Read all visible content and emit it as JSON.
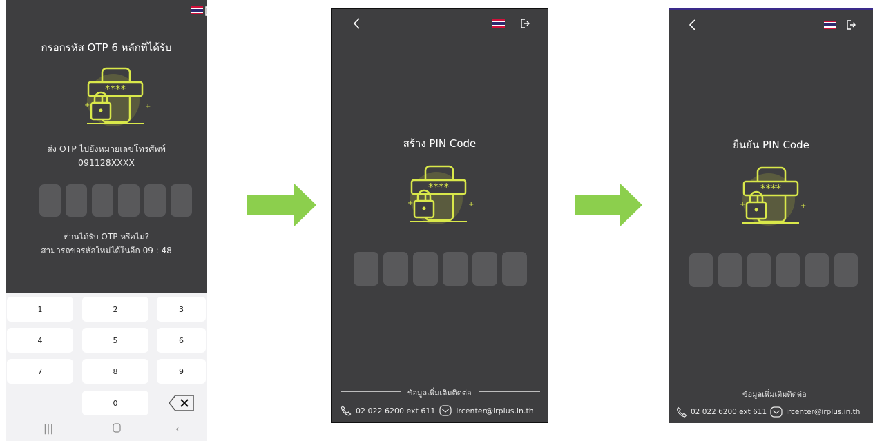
{
  "screen1": {
    "title": "กรอกรหัส OTP 6 หลักที่ได้รับ",
    "send_line1": "ส่ง OTP ไปยังหมายเลขโทรศัพท์",
    "send_line2": "091128XXXX",
    "resend_line1": "ท่านได้รับ OTP หรือไม่?",
    "resend_line2": "สามารถขอรหัสใหม่ได้ในอีก 09 : 48",
    "keys": [
      "1",
      "2",
      "3",
      "4",
      "5",
      "6",
      "7",
      "8",
      "9",
      "0"
    ],
    "icons": [
      "thai-flag-icon",
      "logout-icon",
      "lock-password-illustration",
      "backspace-icon",
      "recents-icon",
      "home-icon",
      "back-nav-icon"
    ]
  },
  "screen2": {
    "title": "สร้าง PIN Code",
    "footer_label": "ข้อมูลเพิ่มเติมติดต่อ",
    "phone": "02 022 6200 ext 611",
    "email": "ircenter@irplus.in.th"
  },
  "screen3": {
    "title": "ยืนยัน PIN Code",
    "footer_label": "ข้อมูลเพิ่มเติมติดต่อ",
    "phone": "02 022 6200 ext 611",
    "email": "ircenter@irplus.in.th"
  },
  "colors": {
    "background": "#3e3e40",
    "accent": "#d9e84a",
    "arrow": "#8ccf4d",
    "input_box": "#59595b"
  }
}
